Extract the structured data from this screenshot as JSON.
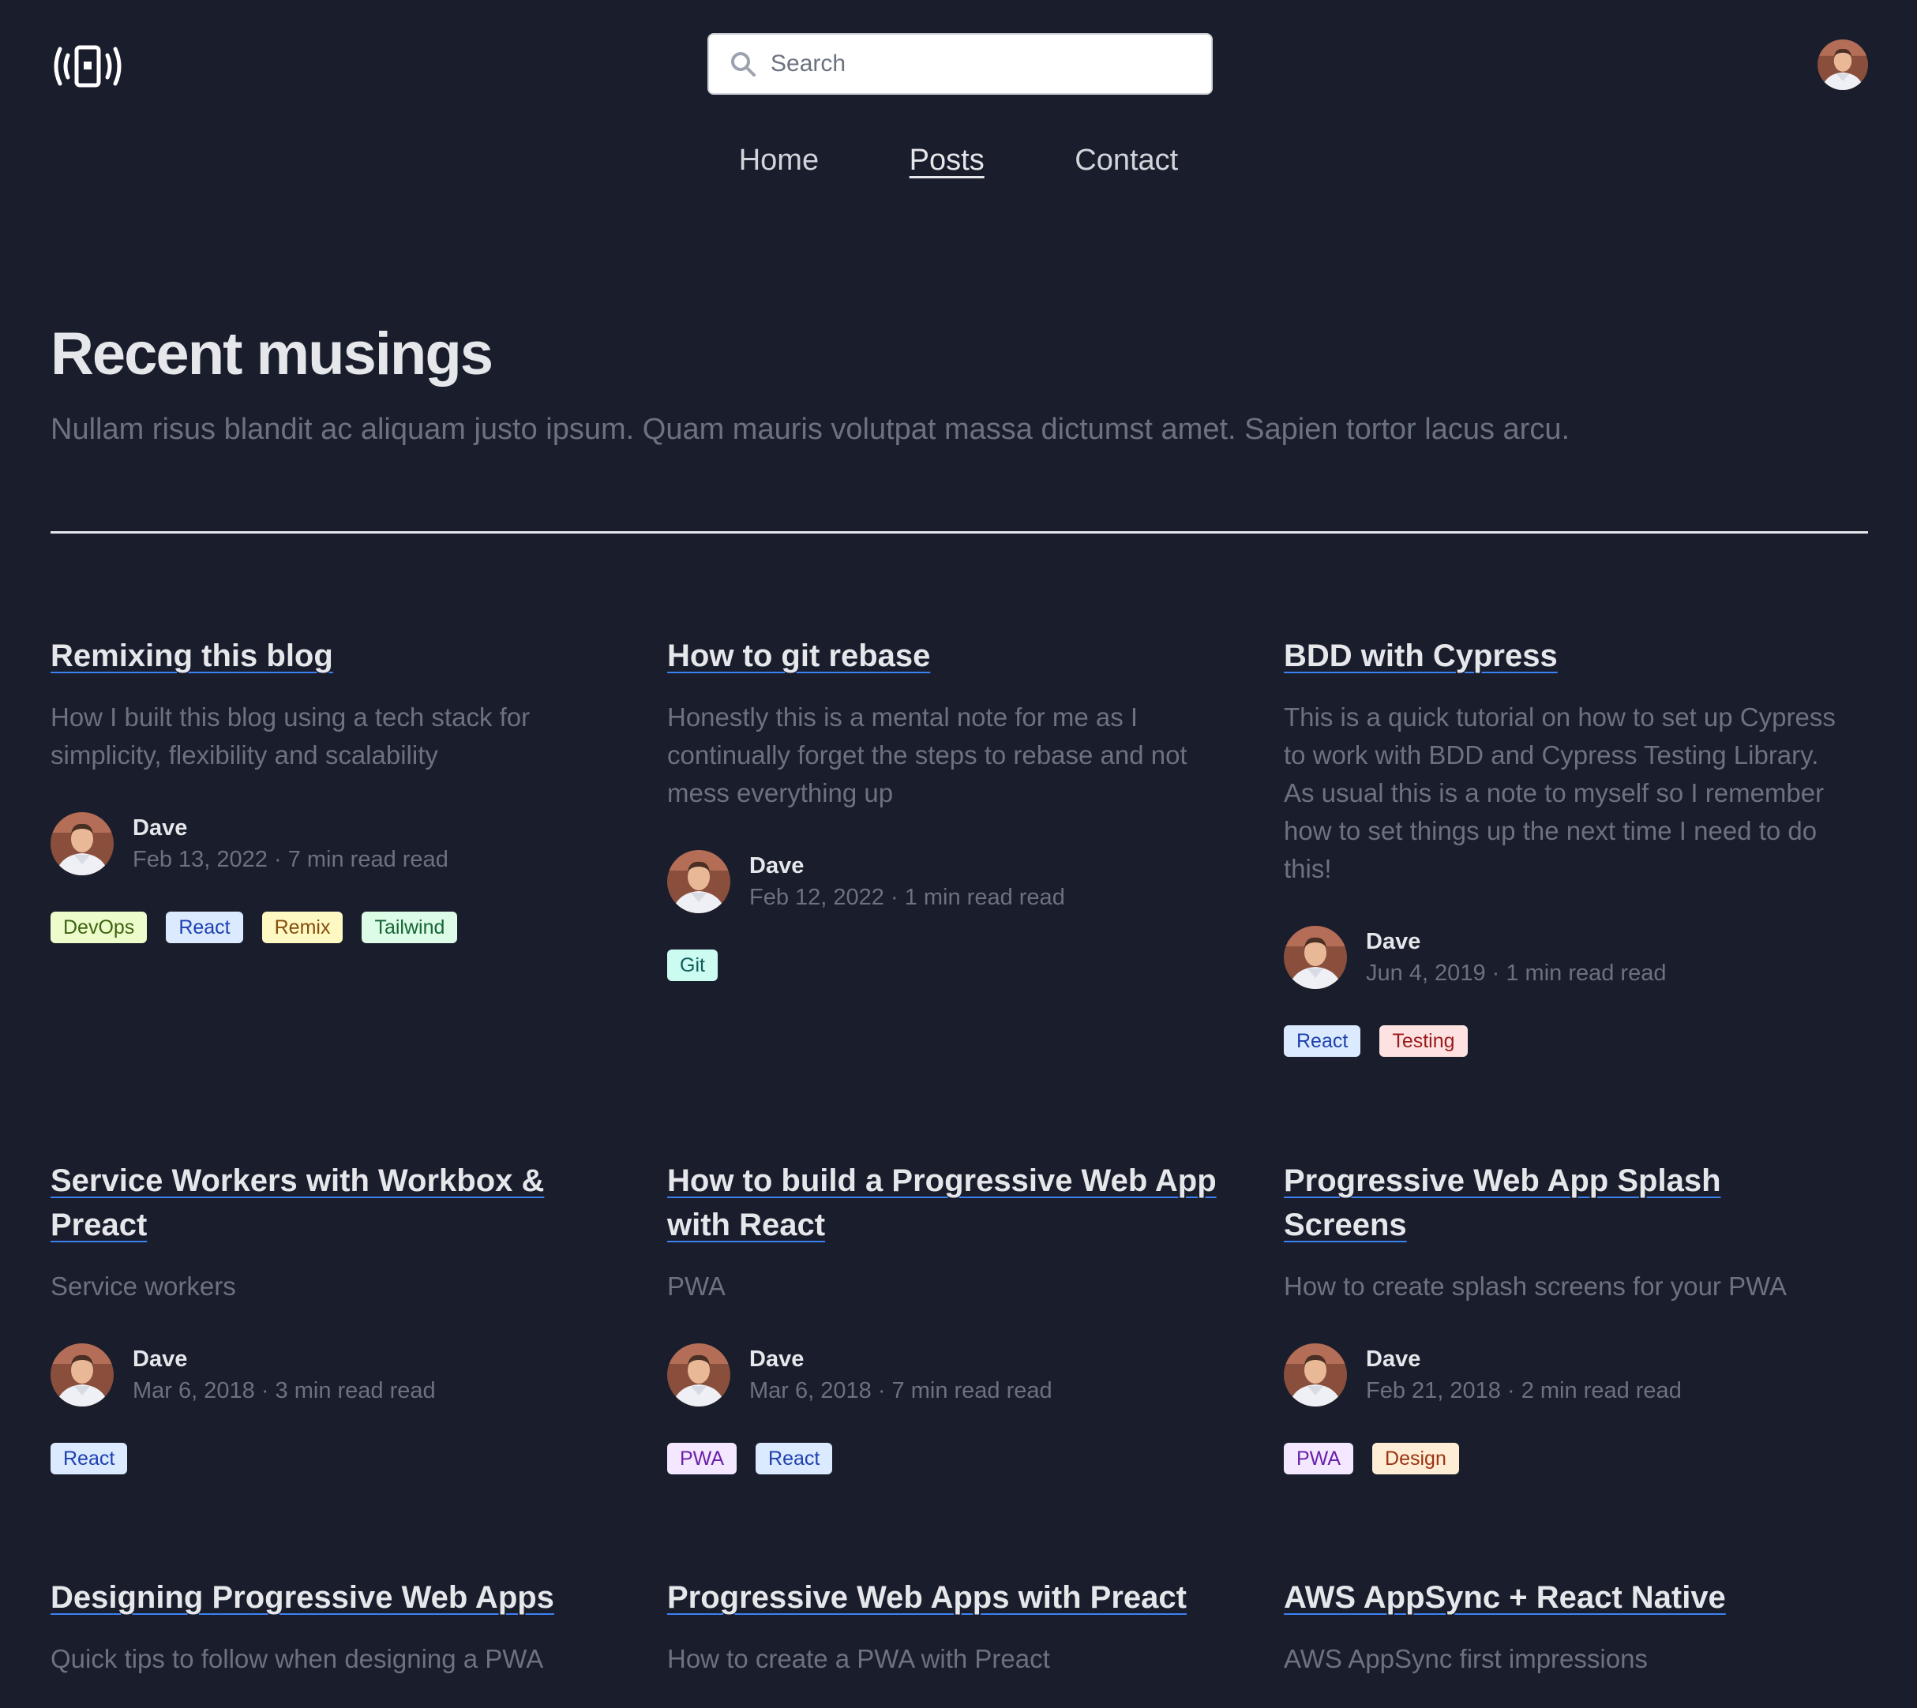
{
  "header": {
    "logo_icon": "vibrating-phone-icon",
    "search": {
      "placeholder": "Search",
      "value": ""
    },
    "avatar_icon": "user-avatar"
  },
  "nav": {
    "items": [
      {
        "label": "Home",
        "active": false
      },
      {
        "label": "Posts",
        "active": true
      },
      {
        "label": "Contact",
        "active": false
      }
    ]
  },
  "hero": {
    "title": "Recent musings",
    "subtitle": "Nullam risus blandit ac aliquam justo ipsum. Quam mauris volutpat massa dictumst amet. Sapien tortor lacus arcu."
  },
  "posts": [
    {
      "title": "Remixing this blog",
      "description": "How I built this blog using a tech stack for simplicity, flexibility and scalability",
      "author": "Dave",
      "date": "Feb 13, 2022",
      "read_time": "7 min read read",
      "tags": [
        "DevOps",
        "React",
        "Remix",
        "Tailwind"
      ]
    },
    {
      "title": "How to git rebase",
      "description": "Honestly this is a mental note for me as I continually forget the steps to rebase and not mess everything up",
      "author": "Dave",
      "date": "Feb 12, 2022",
      "read_time": "1 min read read",
      "tags": [
        "Git"
      ]
    },
    {
      "title": "BDD with Cypress",
      "description": "This is a quick tutorial on how to set up Cypress to work with BDD and Cypress Testing Library. As usual this is a note to myself so I remember how to set things up the next time I need to do this!",
      "author": "Dave",
      "date": "Jun 4, 2019",
      "read_time": "1 min read read",
      "tags": [
        "React",
        "Testing"
      ]
    },
    {
      "title": "Service Workers with Workbox & Preact",
      "description": "Service workers",
      "author": "Dave",
      "date": "Mar 6, 2018",
      "read_time": "3 min read read",
      "tags": [
        "React"
      ]
    },
    {
      "title": "How to build a Progressive Web App with React",
      "description": "PWA",
      "author": "Dave",
      "date": "Mar 6, 2018",
      "read_time": "7 min read read",
      "tags": [
        "PWA",
        "React"
      ]
    },
    {
      "title": "Progressive Web App Splash Screens",
      "description": "How to create splash screens for your PWA",
      "author": "Dave",
      "date": "Feb 21, 2018",
      "read_time": "2 min read read",
      "tags": [
        "PWA",
        "Design"
      ]
    },
    {
      "title": "Designing Progressive Web Apps",
      "description": "Quick tips to follow when designing a PWA"
    },
    {
      "title": "Progressive Web Apps with Preact",
      "description": "How to create a PWA with Preact"
    },
    {
      "title": "AWS AppSync + React Native",
      "description": "AWS AppSync first impressions"
    }
  ],
  "separator": " · ",
  "colors": {
    "background": "#1a1d2b",
    "title_underline": "#3b82f6",
    "muted_text": "#6b7280"
  }
}
